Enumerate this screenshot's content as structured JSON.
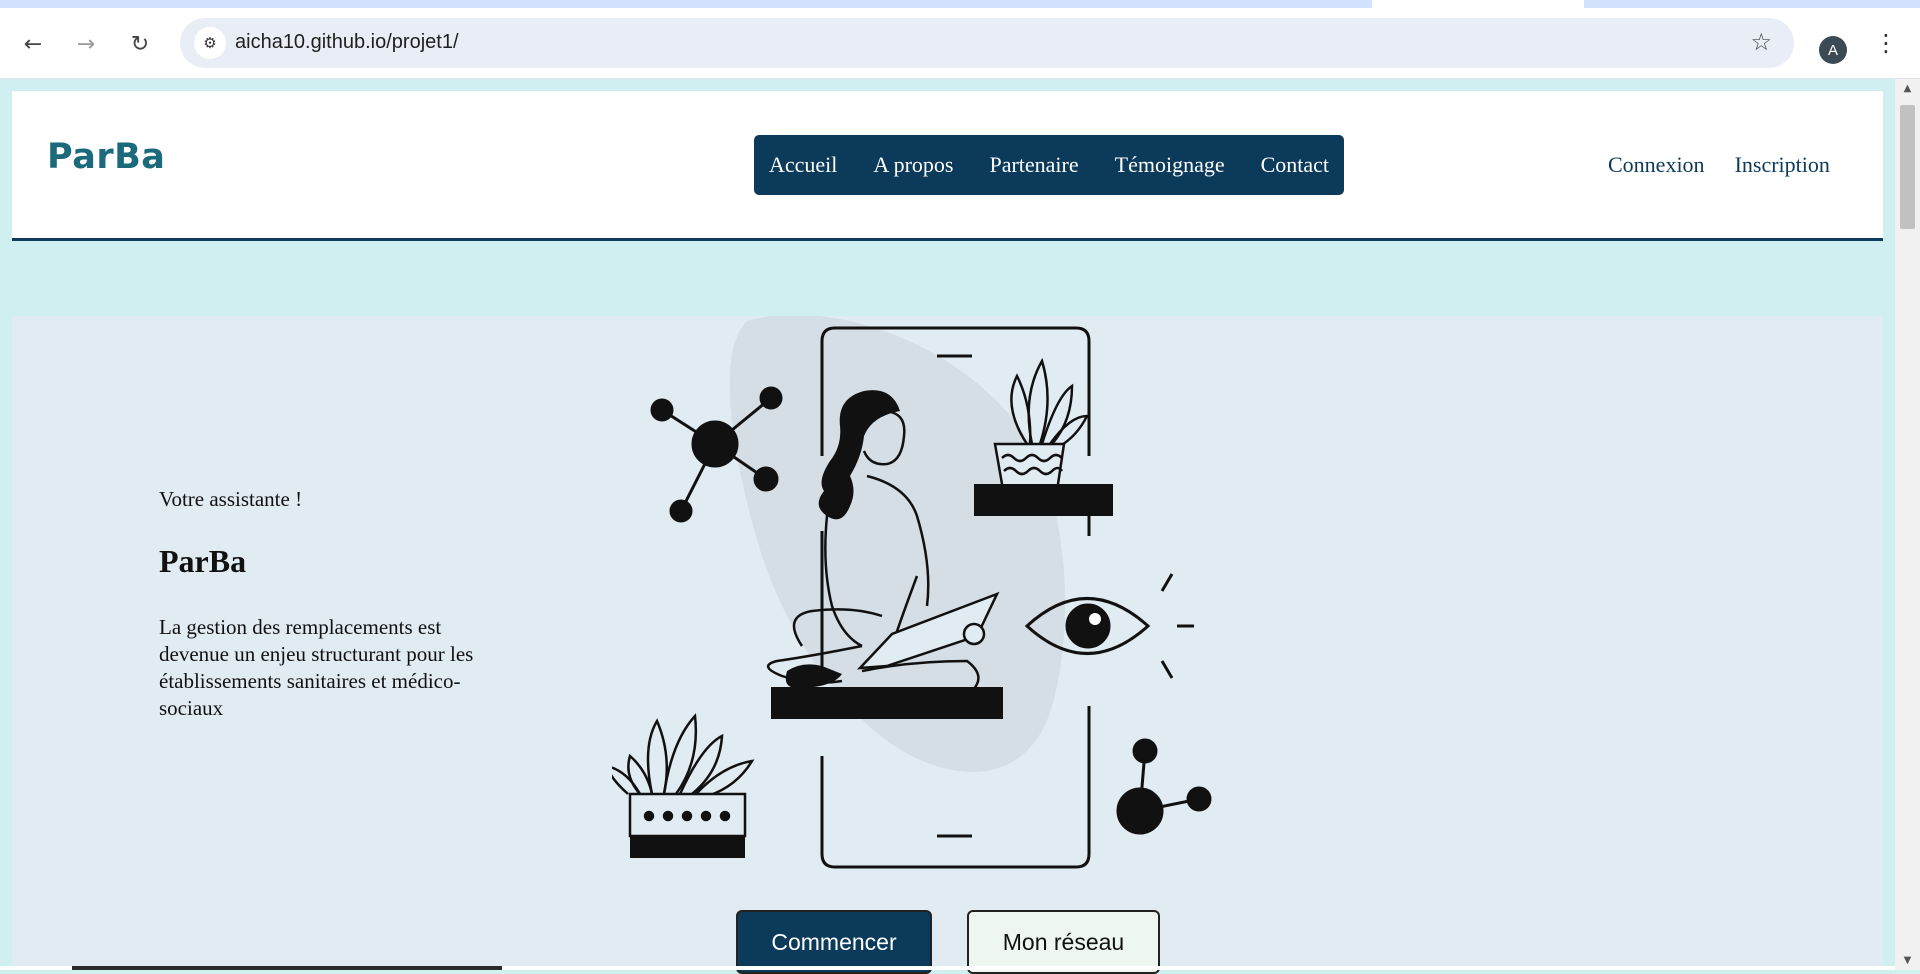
{
  "browser": {
    "url": "aicha10.github.io/projet1/",
    "profile_initial": "A",
    "back_icon": "arrow-left-icon",
    "forward_icon": "arrow-right-icon",
    "reload_icon": "reload-icon",
    "site_settings_icon": "tune-icon",
    "bookmark_icon": "star-icon",
    "menu_icon": "kebab-menu-icon"
  },
  "header": {
    "logo": "ParBa",
    "nav": [
      "Accueil",
      "A propos",
      "Partenaire",
      "Témoignage",
      "Contact"
    ],
    "auth": [
      "Connexion",
      "Inscription"
    ]
  },
  "hero": {
    "eyebrow": "Votre assistante !",
    "title": "ParBa",
    "text": "La gestion des remplacements est devenue un enjeu structurant pour les établissements sanitaires et médico-sociaux",
    "primary_button": "Commencer",
    "secondary_button": "Mon réseau"
  },
  "colors": {
    "page_bg": "#cfeff1",
    "hero_bg": "#e1ebf2",
    "brand_dark": "#0b3a5a",
    "logo": "#1b6a7c"
  }
}
